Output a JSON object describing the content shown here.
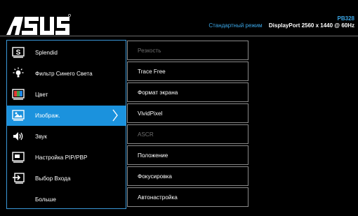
{
  "header": {
    "logo_text": "ASUS",
    "model": "PB328",
    "mode": "Стандартный режим",
    "status": "DisplayPort 2560 x 1440 @ 60Hz"
  },
  "menu": {
    "items": [
      {
        "label": "Splendid",
        "icon": "splendid-s-icon",
        "selected": false
      },
      {
        "label": "Фильтр Синего Света",
        "icon": "bluelight-bulb-icon",
        "selected": false
      },
      {
        "label": "Цвет",
        "icon": "color-palette-icon",
        "selected": false
      },
      {
        "label": "Изображ.",
        "icon": "image-icon",
        "selected": true
      },
      {
        "label": "Звук",
        "icon": "speaker-icon",
        "selected": false
      },
      {
        "label": "Настройка PIP/PBP",
        "icon": "pip-monitor-icon",
        "selected": false
      },
      {
        "label": "Выбор Входа",
        "icon": "input-select-icon",
        "selected": false
      },
      {
        "label": "Больше",
        "icon": "",
        "selected": false
      }
    ]
  },
  "submenu": {
    "items": [
      {
        "label": "Резкость",
        "enabled": false
      },
      {
        "label": "Trace Free",
        "enabled": true
      },
      {
        "label": "Формат экрана",
        "enabled": true
      },
      {
        "label": "VividPixel",
        "enabled": true
      },
      {
        "label": "ASCR",
        "enabled": false
      },
      {
        "label": "Положение",
        "enabled": true
      },
      {
        "label": "Фокусировка",
        "enabled": true
      },
      {
        "label": "Автонастройка",
        "enabled": true
      }
    ]
  },
  "colors": {
    "accent": "#1b92dd",
    "border": "#3a98d8",
    "disabled_text": "#6e6e6e"
  }
}
